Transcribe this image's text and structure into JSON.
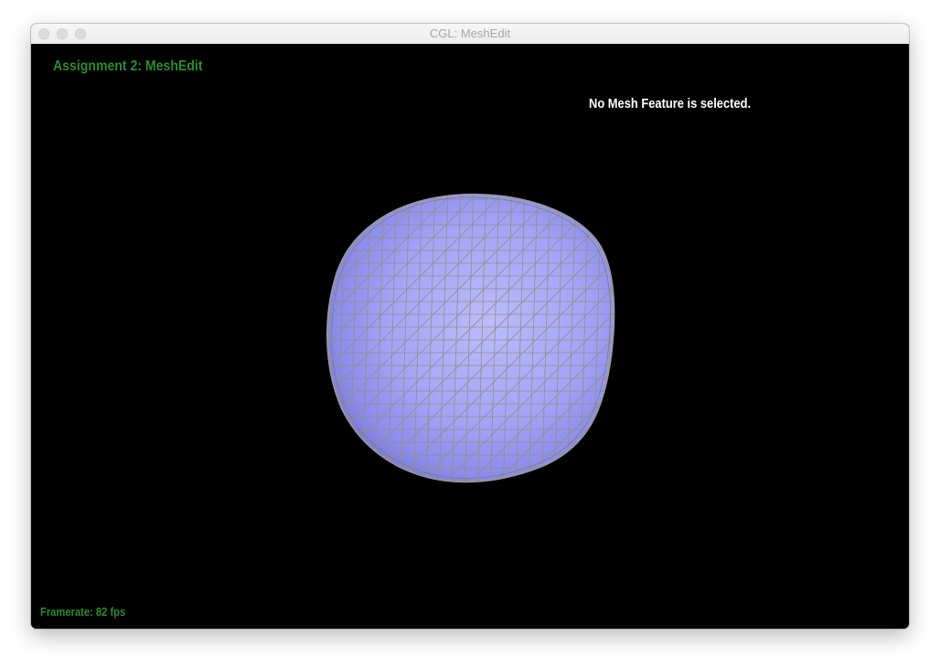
{
  "window": {
    "title": "CGL: MeshEdit"
  },
  "viewport": {
    "heading": "Assignment 2: MeshEdit",
    "selection_status": "No Mesh Feature is selected.",
    "framerate_label": "Framerate:",
    "framerate_value": "82 fps"
  },
  "colors": {
    "heading": "#2e8b2e",
    "background": "#000000",
    "mesh_fill": "#a6a6f8",
    "mesh_shade": "#7b7be6",
    "wireframe": "#8f8f8f"
  },
  "icons": [
    "close-button",
    "minimize-button",
    "zoom-button"
  ]
}
